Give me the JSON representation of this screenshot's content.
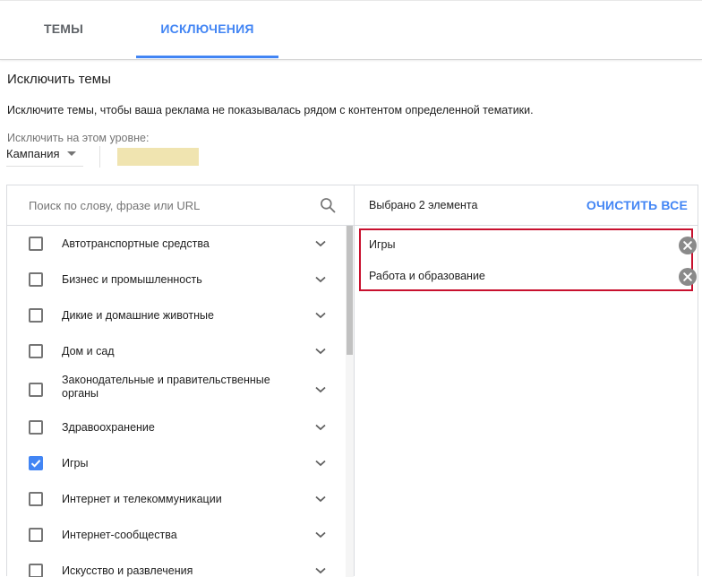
{
  "tabs": [
    {
      "label": "ТЕМЫ",
      "active": false
    },
    {
      "label": "ИСКЛЮЧЕНИЯ",
      "active": true
    }
  ],
  "heading": "Исключить темы",
  "description": "Исключите темы, чтобы ваша реклама не показывалась рядом с контентом определенной тематики.",
  "level": {
    "label": "Исключить на этом уровне:",
    "selected": "Кампания"
  },
  "search": {
    "placeholder": "Поиск по слову, фразе или URL",
    "value": ""
  },
  "topics": [
    {
      "label": "Автотранспортные средства",
      "checked": false
    },
    {
      "label": "Бизнес и промышленность",
      "checked": false
    },
    {
      "label": "Дикие и домашние животные",
      "checked": false
    },
    {
      "label": "Дом и сад",
      "checked": false
    },
    {
      "label": "Законодательные и правительственные органы",
      "checked": false
    },
    {
      "label": "Здравоохранение",
      "checked": false
    },
    {
      "label": "Игры",
      "checked": true
    },
    {
      "label": "Интернет и телекоммуникации",
      "checked": false
    },
    {
      "label": "Интернет-сообщества",
      "checked": false
    },
    {
      "label": "Искусство и развлечения",
      "checked": false
    }
  ],
  "selection": {
    "count_text": "Выбрано 2 элемента",
    "clear_all": "ОЧИСТИТЬ ВСЕ",
    "items": [
      {
        "label": "Игры"
      },
      {
        "label": "Работа и образование"
      }
    ]
  },
  "colors": {
    "accent": "#4285f4",
    "highlight_border": "#c8102e",
    "redacted_fill": "#f0e4b0"
  },
  "icons": {
    "search": "search-icon",
    "expand": "chevron-down-icon",
    "remove": "remove-circle-icon",
    "dropdown": "dropdown-arrow-icon",
    "check": "check-icon"
  }
}
